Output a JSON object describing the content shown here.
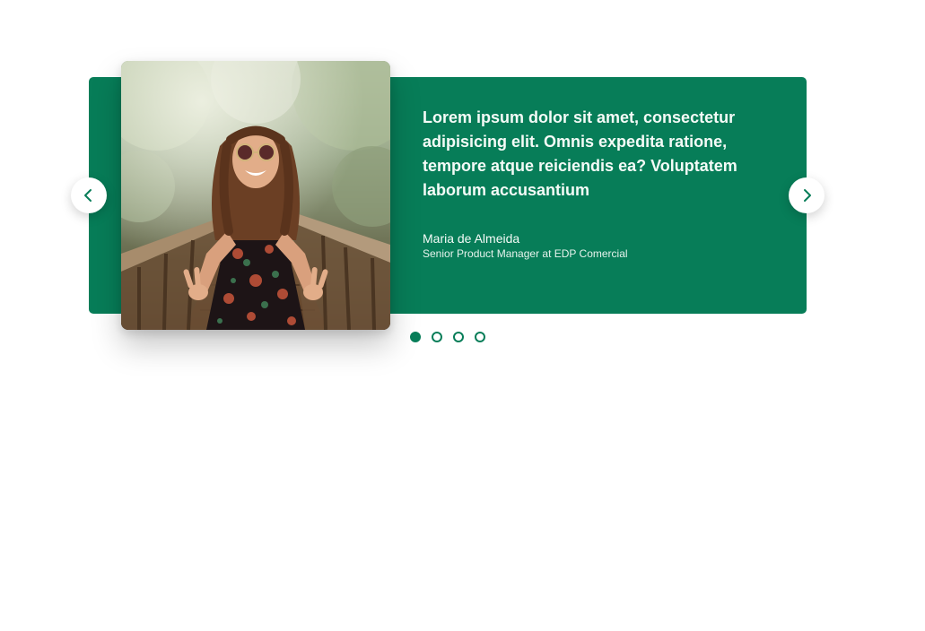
{
  "colors": {
    "accent": "#077d58",
    "card_text": "#f4fbf7",
    "background": "#ffffff"
  },
  "testimonial": {
    "quote": "Lorem ipsum dolor sit amet, consectetur adipisicing elit. Omnis expedita ratione, tempore atque reiciendis ea? Voluptatem laborum accusantium",
    "author_name": "Maria de Almeida",
    "author_role": "Senior Product Manager at EDP Comercial",
    "photo_alt": "Smiling woman with sunglasses and floral dress making peace signs on a wooden bridge"
  },
  "navigation": {
    "prev_icon": "chevron-left-icon",
    "next_icon": "chevron-right-icon"
  },
  "pagination": {
    "total": 4,
    "active_index": 0
  }
}
